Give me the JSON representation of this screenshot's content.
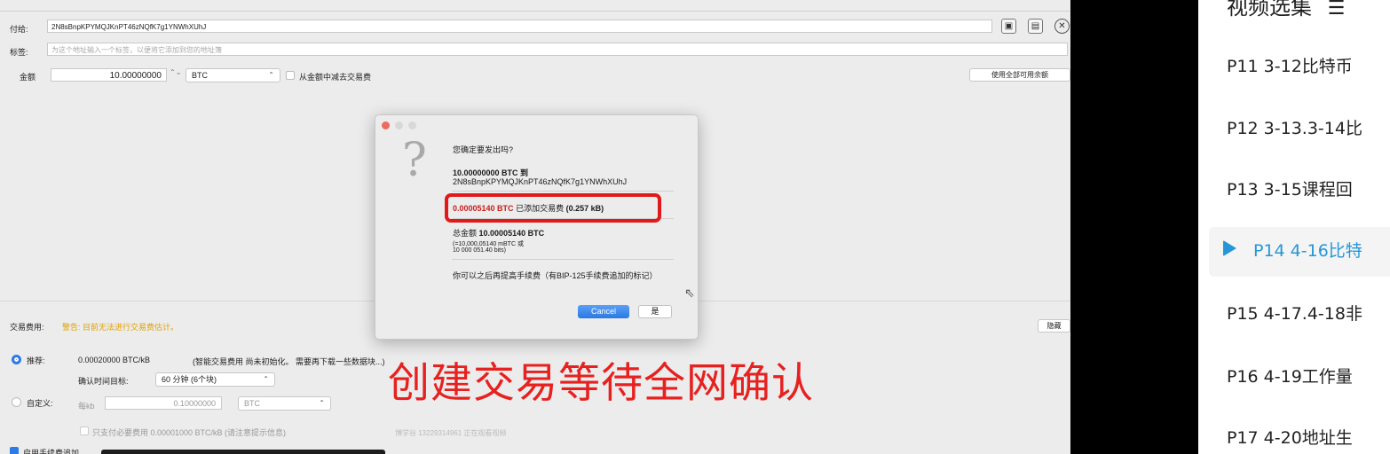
{
  "wallet": {
    "pay_to_label": "付给:",
    "pay_to_value": "2N8sBnpKPYMQJKnPT46zNQfK7g1YNWhXUhJ",
    "label_label": "标签:",
    "label_placeholder": "为这个地址输入一个标签，以便将它添加到您的地址簿",
    "amount_label": "金额",
    "amount_value": "10.00000000",
    "unit": "BTC",
    "subtract_fee_label": "从金额中减去交易费",
    "use_all_label": "使用全部可用余额",
    "fee_label": "交易费用:",
    "fee_warning": "警告: 目前无法进行交易费估计。",
    "hide_label": "隐藏",
    "recommended_label": "推荐:",
    "recommended_value": "0.00020000 BTC/kB",
    "recommended_note": "(智能交易费用 尚未初始化。 需要再下载一些数据块...)",
    "confirm_target_label": "确认时间目标:",
    "confirm_target_value": "60 分钟 (6个块)",
    "custom_label": "自定义:",
    "per_kb_label": "每kb",
    "custom_value": "0.10000000",
    "custom_unit": "BTC",
    "min_fee_label": "只支付必要费用 0.00001000 BTC/kB  (请注意提示信息)",
    "watermark": "博学谷 13229314961 正在观看视频",
    "enable_rbf_label": "启用手续费追加"
  },
  "dialog": {
    "question": "您确定要发出吗?",
    "amount_line": "10.00000000 BTC 到",
    "address": "2N8sBnpKPYMQJKnPT46zNQfK7g1YNWhXUhJ",
    "fee_amount": "0.00005140 BTC",
    "fee_text": "已添加交易费",
    "fee_size": "(0.257 kB)",
    "total_label": "总金额",
    "total_value": "10.00005140 BTC",
    "total_sub1": "(=10,000,05140 mBTC 或",
    "total_sub2": "10 000 051.40 bits)",
    "rbf_note": "你可以之后再提高手续费（有BIP-125手续费追加的标记）",
    "cancel_label": "Cancel",
    "yes_label": "是",
    "help_glyph": "?"
  },
  "overlay": {
    "caption": "创建交易等待全网确认"
  },
  "sidebar": {
    "title": "视频选集",
    "items": [
      {
        "label": "P11   3-12比特币"
      },
      {
        "label": "P12   3-13.3-14比"
      },
      {
        "label": "P13   3-15课程回"
      },
      {
        "label": "P14   4-16比特"
      },
      {
        "label": "P15   4-17.4-18非"
      },
      {
        "label": "P16   4-19工作量"
      },
      {
        "label": "P17   4-20地址生"
      }
    ],
    "active_color": "#2596d8"
  }
}
